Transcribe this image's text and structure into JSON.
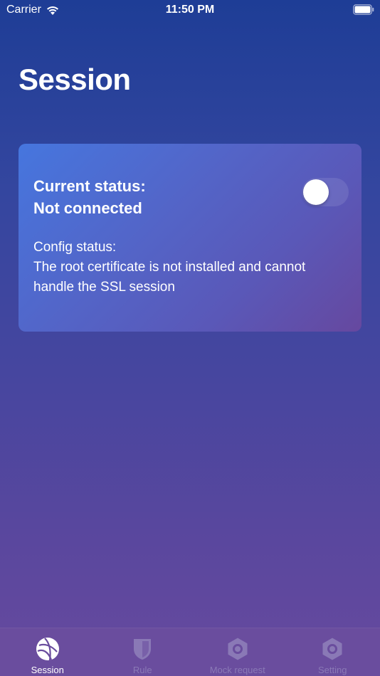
{
  "status_bar": {
    "carrier": "Carrier",
    "time": "11:50 PM"
  },
  "page": {
    "title": "Session"
  },
  "card": {
    "current_label": "Current status:",
    "connection_value": "Not connected",
    "toggle_on": false,
    "config_label": "Config status:",
    "config_message": "The root certificate is not installed and cannot handle the SSL session"
  },
  "tabs": [
    {
      "label": "Session",
      "icon": "globe-icon",
      "active": true
    },
    {
      "label": "Rule",
      "icon": "shield-icon",
      "active": false
    },
    {
      "label": "Mock request",
      "icon": "hexagon-icon",
      "active": false
    },
    {
      "label": "Setting",
      "icon": "settings-icon",
      "active": false
    }
  ],
  "colors": {
    "tab_active": "#ffffff",
    "tab_inactive": "#8a79b6",
    "toggle_knob": "#ffffff"
  }
}
